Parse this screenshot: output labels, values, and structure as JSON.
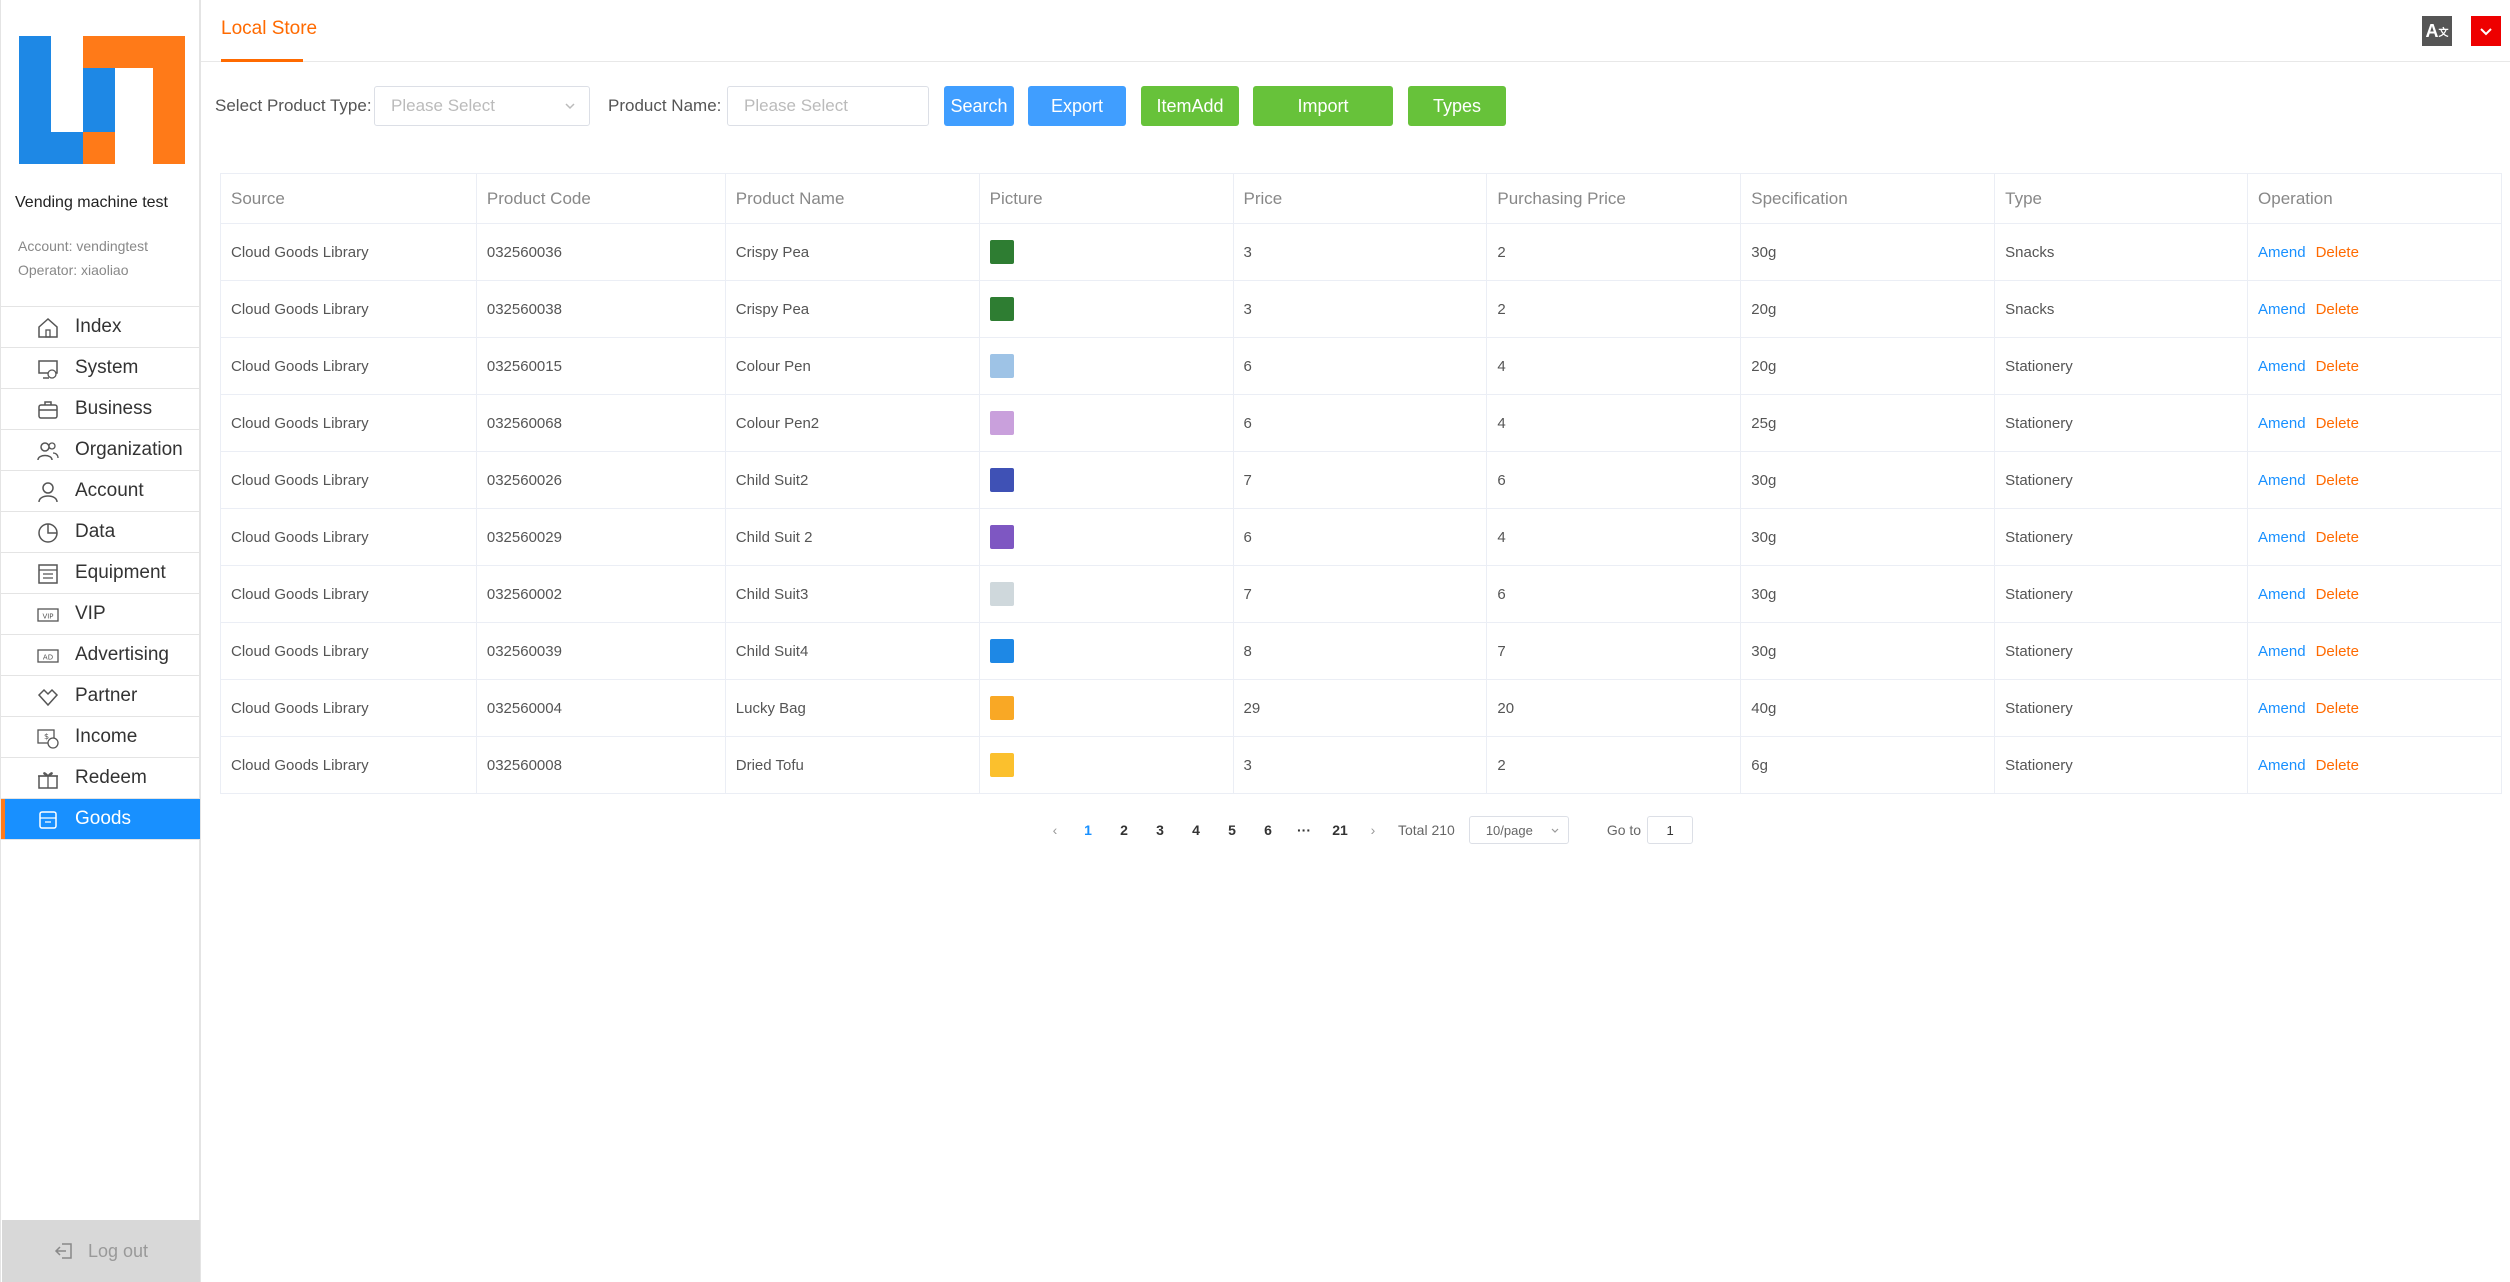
{
  "sidebar": {
    "machine_name": "Vending machine test",
    "account_line": "Account:  vendingtest",
    "operator_line": "Operator:  xiaoliao",
    "items": [
      {
        "label": "Index",
        "icon": "home-icon"
      },
      {
        "label": "System",
        "icon": "system-icon"
      },
      {
        "label": "Business",
        "icon": "briefcase-icon"
      },
      {
        "label": "Organization",
        "icon": "users-icon"
      },
      {
        "label": "Account",
        "icon": "user-icon"
      },
      {
        "label": "Data",
        "icon": "pie-chart-icon"
      },
      {
        "label": "Equipment",
        "icon": "equipment-icon"
      },
      {
        "label": "VIP",
        "icon": "vip-icon"
      },
      {
        "label": "Advertising",
        "icon": "ad-icon"
      },
      {
        "label": "Partner",
        "icon": "handshake-icon"
      },
      {
        "label": "Income",
        "icon": "income-icon"
      },
      {
        "label": "Redeem",
        "icon": "gift-icon"
      },
      {
        "label": "Goods",
        "icon": "goods-icon"
      }
    ],
    "active_item": "Goods",
    "logout_label": "Log out"
  },
  "header": {
    "tab_label": "Local Store",
    "lang_icon": "translate-icon",
    "user_icon": "user-menu-icon"
  },
  "filters": {
    "type_label": "Select Product Type:",
    "type_placeholder": "Please Select",
    "name_label": "Product Name:",
    "name_placeholder": "Please Select",
    "search_label": "Search",
    "export_label": "Export",
    "itemadd_label": "ItemAdd",
    "import_label": "Import",
    "types_label": "Types"
  },
  "table": {
    "columns": [
      "Source",
      "Product Code",
      "Product Name",
      "Picture",
      "Price",
      "Purchasing Price",
      "Specification",
      "Type",
      "Operation"
    ],
    "amend_label": "Amend",
    "delete_label": "Delete",
    "rows": [
      {
        "source": "Cloud Goods Library",
        "code": "032560036",
        "name": "Crispy Pea",
        "pic_color": "#2e7d32",
        "price": "3",
        "purchasing": "2",
        "spec": "30g",
        "type": "Snacks"
      },
      {
        "source": "Cloud Goods Library",
        "code": "032560038",
        "name": "Crispy Pea",
        "pic_color": "#2e7d32",
        "price": "3",
        "purchasing": "2",
        "spec": "20g",
        "type": "Snacks"
      },
      {
        "source": "Cloud Goods Library",
        "code": "032560015",
        "name": "Colour Pen",
        "pic_color": "#9ec3e6",
        "price": "6",
        "purchasing": "4",
        "spec": "20g",
        "type": "Stationery"
      },
      {
        "source": "Cloud Goods Library",
        "code": "032560068",
        "name": "Colour Pen2",
        "pic_color": "#c9a0dc",
        "price": "6",
        "purchasing": "4",
        "spec": "25g",
        "type": "Stationery"
      },
      {
        "source": "Cloud Goods Library",
        "code": "032560026",
        "name": "Child Suit2",
        "pic_color": "#3f51b5",
        "price": "7",
        "purchasing": "6",
        "spec": "30g",
        "type": "Stationery"
      },
      {
        "source": "Cloud Goods Library",
        "code": "032560029",
        "name": "Child Suit 2",
        "pic_color": "#7e57c2",
        "price": "6",
        "purchasing": "4",
        "spec": "30g",
        "type": "Stationery"
      },
      {
        "source": "Cloud Goods Library",
        "code": "032560002",
        "name": "Child Suit3",
        "pic_color": "#cfd8dc",
        "price": "7",
        "purchasing": "6",
        "spec": "30g",
        "type": "Stationery"
      },
      {
        "source": "Cloud Goods Library",
        "code": "032560039",
        "name": "Child Suit4",
        "pic_color": "#1e88e5",
        "price": "8",
        "purchasing": "7",
        "spec": "30g",
        "type": "Stationery"
      },
      {
        "source": "Cloud Goods Library",
        "code": "032560004",
        "name": "Lucky Bag",
        "pic_color": "#f9a825",
        "price": "29",
        "purchasing": "20",
        "spec": "40g",
        "type": "Stationery"
      },
      {
        "source": "Cloud Goods Library",
        "code": "032560008",
        "name": "Dried Tofu",
        "pic_color": "#fbc02d",
        "price": "3",
        "purchasing": "2",
        "spec": "6g",
        "type": "Stationery"
      }
    ]
  },
  "pagination": {
    "prev_icon": "chevron-left-icon",
    "next_icon": "chevron-right-icon",
    "pages": [
      "1",
      "2",
      "3",
      "4",
      "5",
      "6",
      "···",
      "21"
    ],
    "current": "1",
    "total_label": "Total 210",
    "page_size": "10/page",
    "goto_label": "Go to",
    "goto_value": "1"
  }
}
